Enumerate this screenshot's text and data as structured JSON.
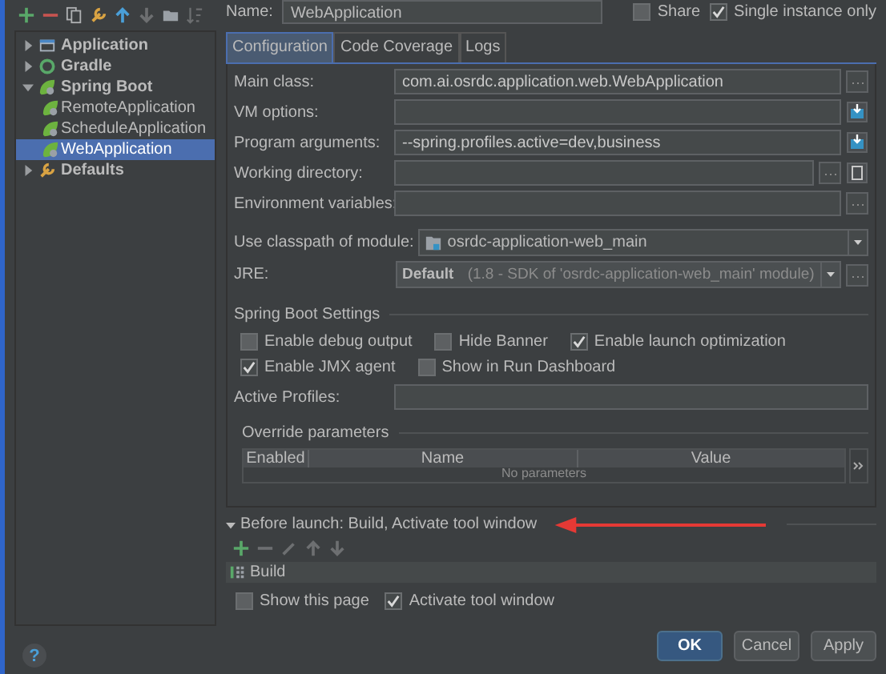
{
  "tree": [
    {
      "label": "Application",
      "expanded": false,
      "selected": false
    },
    {
      "label": "Gradle",
      "expanded": false,
      "selected": false
    },
    {
      "label": "Spring Boot",
      "expanded": true,
      "selected": false,
      "children": [
        {
          "label": "RemoteApplication",
          "selected": false
        },
        {
          "label": "ScheduleApplication",
          "selected": false
        },
        {
          "label": "WebApplication",
          "selected": true
        }
      ]
    },
    {
      "label": "Defaults",
      "expanded": false,
      "selected": false
    }
  ],
  "help": "?",
  "name": {
    "label": "Name:",
    "value": "WebApplication"
  },
  "share": {
    "label": "Share",
    "checked": false
  },
  "single_instance": {
    "label": "Single instance only",
    "checked": true
  },
  "tabs": [
    {
      "label": "Configuration",
      "selected": true
    },
    {
      "label": "Code Coverage",
      "selected": false
    },
    {
      "label": "Logs",
      "selected": false
    }
  ],
  "fields": [
    {
      "label": "Main class:",
      "value": "com.ai.osrdc.application.web.WebApplication"
    },
    {
      "label": "VM options:"
    },
    {
      "label": "Program arguments:",
      "value": "--spring.profiles.active=dev,business"
    },
    {
      "label": "Working directory:"
    },
    {
      "label": "Environment variables:"
    }
  ],
  "classpath": {
    "label": "Use classpath of module:",
    "value": "osrdc-application-web_main"
  },
  "jre": {
    "label": "JRE:",
    "value": "Default",
    "detail": "(1.8 - SDK of 'osrdc-application-web_main' module)"
  },
  "spring_boot_settings": {
    "title": "Spring Boot Settings",
    "options": [
      {
        "label": "Enable debug output",
        "checked": false
      },
      {
        "label": "Hide Banner",
        "checked": false
      },
      {
        "label": "Enable launch optimization",
        "checked": true
      },
      {
        "label": "Enable JMX agent",
        "checked": true
      },
      {
        "label": "Show in Run Dashboard",
        "checked": false
      }
    ],
    "active_profiles": {
      "label": "Active Profiles:"
    }
  },
  "override_parameters": {
    "title": "Override parameters",
    "columns": [
      "Enabled",
      "Name",
      "Value"
    ],
    "empty_text": "No parameters"
  },
  "before_launch": {
    "title": "Before launch: Build, Activate tool window",
    "expanded": true,
    "tasks": [
      "Build"
    ],
    "options": [
      {
        "label": "Show this page",
        "checked": false
      },
      {
        "label": "Activate tool window",
        "checked": true
      }
    ]
  },
  "buttons": [
    {
      "label": "OK",
      "default": true
    },
    {
      "label": "Cancel",
      "default": false
    },
    {
      "label": "Apply",
      "default": false
    }
  ]
}
